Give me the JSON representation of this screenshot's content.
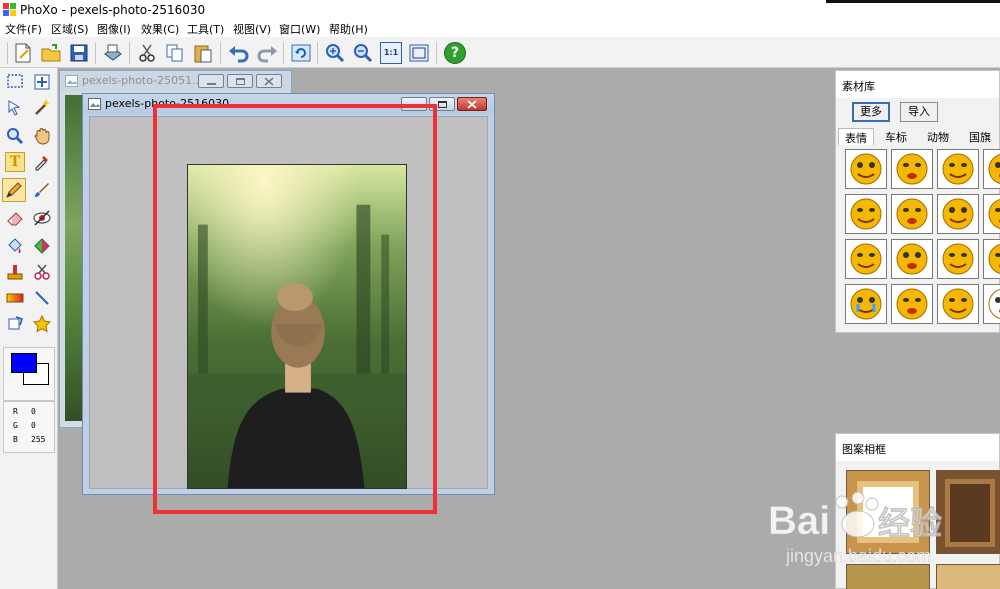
{
  "window": {
    "title": "PhoXo - pexels-photo-2516030"
  },
  "menu": [
    {
      "label": "文件(F)"
    },
    {
      "label": "区域(S)"
    },
    {
      "label": "图像(I)"
    },
    {
      "label": "效果(C)"
    },
    {
      "label": "工具(T)"
    },
    {
      "label": "视图(V)"
    },
    {
      "label": "窗口(W)"
    },
    {
      "label": "帮助(H)"
    }
  ],
  "toolbar": {
    "buttons": [
      "new-icon",
      "open-icon",
      "save-icon",
      "scan-icon",
      "cut-icon",
      "copy-icon",
      "paste-icon",
      "undo-icon",
      "redo-icon",
      "refresh-icon",
      "zoom-in-icon",
      "zoom-out-icon",
      "actual-size-icon",
      "fit-window-icon",
      "help-icon"
    ],
    "actual_size_label": "1:1",
    "help_label": "?"
  },
  "tools": {
    "text_tool_label": "T",
    "fg_color": "#0000ff",
    "bg_color": "#ffffff",
    "rgb": [
      {
        "label": "R",
        "value": "0"
      },
      {
        "label": "G",
        "value": "0"
      },
      {
        "label": "B",
        "value": "255"
      }
    ]
  },
  "windows": {
    "back": {
      "title": "pexels-photo-25051..."
    },
    "front": {
      "title": "pexels-photo-2516030"
    }
  },
  "highlight_color": "#ee3135",
  "library": {
    "title": "素材库",
    "more_button": "更多",
    "import_button": "导入",
    "tabs": [
      "表情",
      "车标",
      "动物",
      "国旗"
    ]
  },
  "frames_panel": {
    "title": "图案相框"
  },
  "watermark": {
    "brand": "Bai",
    "brand2": "经验",
    "url": "jingyan.baidu.com"
  }
}
